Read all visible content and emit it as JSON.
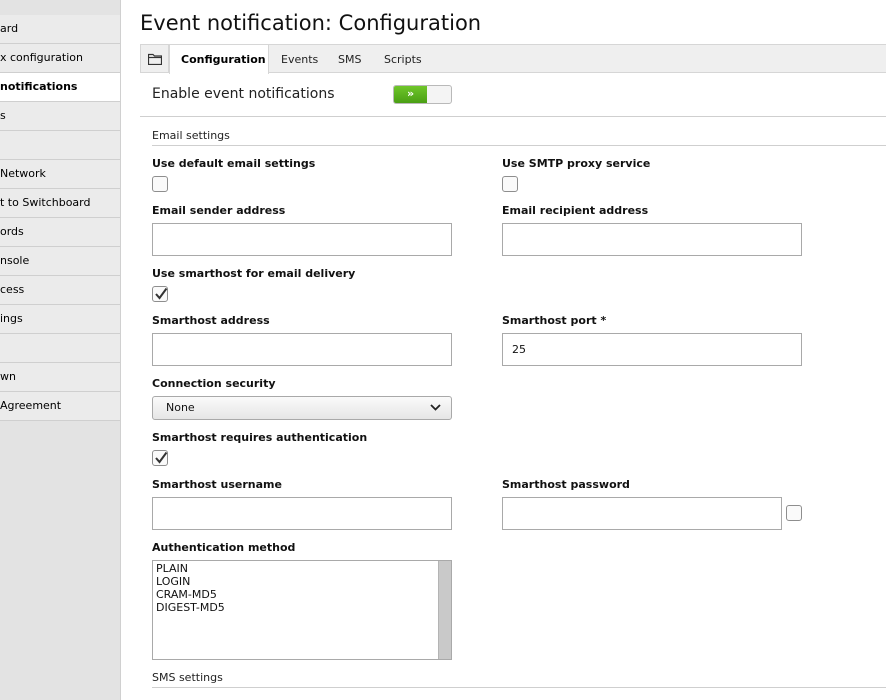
{
  "sidebar": {
    "items": [
      {
        "label": "ard"
      },
      {
        "label": "x configuration"
      },
      {
        "label": "notifications"
      },
      {
        "label": "s"
      },
      {
        "label": ""
      },
      {
        "label": "Network"
      },
      {
        "label": "t to Switchboard"
      },
      {
        "label": "ords"
      },
      {
        "label": "nsole"
      },
      {
        "label": "cess"
      },
      {
        "label": "ings"
      },
      {
        "label": ""
      },
      {
        "label": "wn"
      },
      {
        "label": " Agreement"
      }
    ]
  },
  "page": {
    "title": "Event notification: Configuration"
  },
  "tabs": [
    {
      "label": "Configuration",
      "active": true
    },
    {
      "label": "Events"
    },
    {
      "label": "SMS"
    },
    {
      "label": "Scripts"
    }
  ],
  "enable": {
    "label": "Enable event notifications",
    "toggle_text": "»",
    "state": "on"
  },
  "email_settings": {
    "section_label": "Email settings",
    "use_default_label": "Use default email settings",
    "use_default_checked": false,
    "use_smtp_proxy_label": "Use SMTP proxy service",
    "use_smtp_proxy_checked": false,
    "sender_label": "Email sender address",
    "sender_value": "",
    "recipient_label": "Email recipient address",
    "recipient_value": "",
    "use_smarthost_label": "Use smarthost for email delivery",
    "use_smarthost_checked": true,
    "smarthost_address_label": "Smarthost address",
    "smarthost_address_value": "",
    "smarthost_port_label": "Smarthost port *",
    "smarthost_port_value": "25",
    "connection_security_label": "Connection security",
    "connection_security_value": "None",
    "requires_auth_label": "Smarthost requires authentication",
    "requires_auth_checked": true,
    "username_label": "Smarthost username",
    "username_value": "",
    "password_label": "Smarthost password",
    "password_value": "",
    "show_password_checked": false,
    "auth_method_label": "Authentication method",
    "auth_methods": [
      "PLAIN",
      "LOGIN",
      "CRAM-MD5",
      "DIGEST-MD5"
    ]
  },
  "sms_settings": {
    "section_label": "SMS settings"
  },
  "colors": {
    "toggle_on": "#5cb31f",
    "active_tab": "#ffffff",
    "sidebar": "#e3e3e3"
  },
  "icons": {
    "tab_home": "folder-icon",
    "select_arrow": "chevron-down-icon",
    "check": "check-icon"
  }
}
